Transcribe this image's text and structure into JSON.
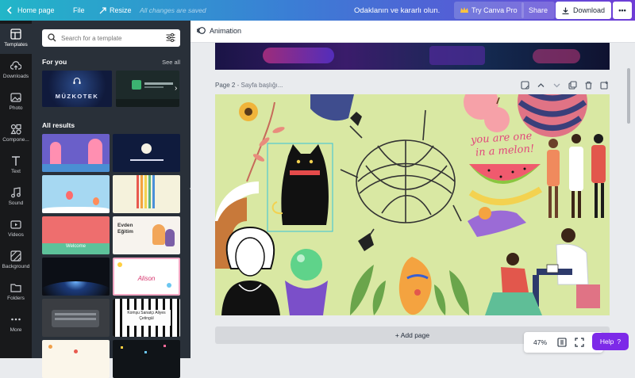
{
  "topbar": {
    "home_label": "Home page",
    "file_label": "File",
    "resize_label": "Resize",
    "saved_status": "All changes are saved",
    "design_title": "Odaklanın ve kararlı olun.",
    "try_pro_label": "Try Canva Pro",
    "share_label": "Share",
    "download_label": "Download",
    "more_label": "•••"
  },
  "rail": {
    "items": [
      {
        "label": "Templates",
        "icon": "templates-icon"
      },
      {
        "label": "Downloads",
        "icon": "cloud-upload-icon"
      },
      {
        "label": "Photo",
        "icon": "photo-icon"
      },
      {
        "label": "Compone...",
        "icon": "elements-icon"
      },
      {
        "label": "Text",
        "icon": "text-icon"
      },
      {
        "label": "Sound",
        "icon": "music-icon"
      },
      {
        "label": "Videos",
        "icon": "video-icon"
      },
      {
        "label": "Background",
        "icon": "background-icon"
      },
      {
        "label": "Folders",
        "icon": "folder-icon"
      },
      {
        "label": "More",
        "icon": "more-icon"
      }
    ]
  },
  "panel": {
    "search_placeholder": "Search for a template",
    "for_you_title": "For you",
    "see_all_label": "See all",
    "all_results_title": "All results",
    "for_you_items": [
      {
        "text": "MÜZKOTEK"
      },
      {
        "text": ""
      }
    ],
    "results": [
      {
        "text": "",
        "bg": "#6a5fc9"
      },
      {
        "text": "",
        "bg": "#0f1b3d"
      },
      {
        "text": "",
        "bg": "#a6d8f2"
      },
      {
        "text": "",
        "bg": "#f5f2dc"
      },
      {
        "text": "Welcome",
        "bg": "#ee6e6e"
      },
      {
        "text": "Evden Eğitim",
        "bg": "#f7f3ee"
      },
      {
        "text": "",
        "bg": "#0c0f16"
      },
      {
        "text": "Alison",
        "bg": "#ffffff"
      },
      {
        "text": "",
        "bg": "#3a3d42"
      },
      {
        "text": "Komşu Sanatçı Aliyes Çetingül",
        "bg": "#fdfdfd"
      },
      {
        "text": "",
        "bg": "#fbf6ea"
      },
      {
        "text": "",
        "bg": "#101418"
      }
    ]
  },
  "editor": {
    "animation_label": "Animation",
    "page_label": "Page 2",
    "page_title_placeholder": "- Sayfa başlığı...",
    "melon_text_1": "you are one",
    "melon_text_2": "in a melon!",
    "add_page_label": "+ Add page",
    "zoom_level": "47%",
    "help_label": "Help",
    "help_icon": "?"
  },
  "colors": {
    "accent_purple": "#7d2ae8",
    "canvas_bg": "#d9e8a3",
    "panel_bg": "#293039",
    "rail_bg": "#18191b"
  }
}
